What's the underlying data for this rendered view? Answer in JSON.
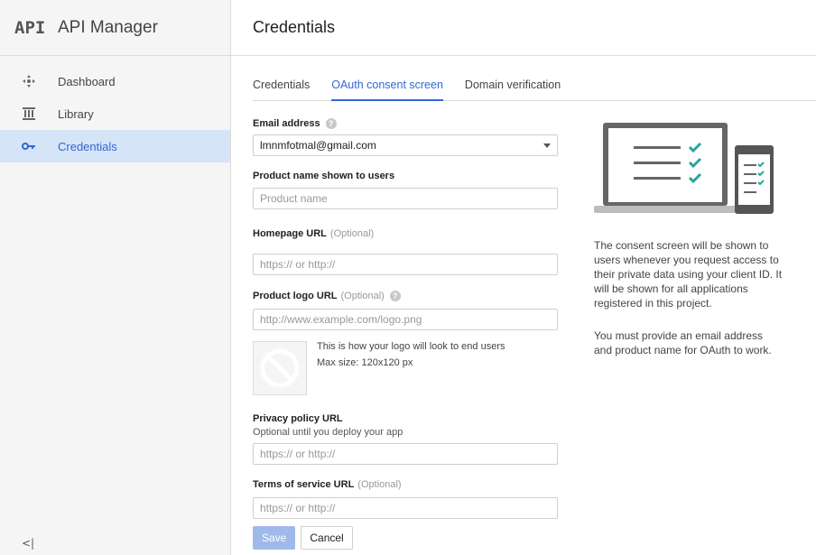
{
  "sidebar": {
    "logo": "API",
    "title": "API Manager",
    "items": [
      {
        "label": "Dashboard",
        "icon": "dashboard-icon"
      },
      {
        "label": "Library",
        "icon": "library-icon"
      },
      {
        "label": "Credentials",
        "icon": "key-icon",
        "active": true
      }
    ],
    "collapse": "<|"
  },
  "header": {
    "title": "Credentials"
  },
  "tabs": [
    {
      "label": "Credentials"
    },
    {
      "label": "OAuth consent screen",
      "active": true
    },
    {
      "label": "Domain verification"
    }
  ],
  "form": {
    "email": {
      "label": "Email address",
      "value": "lmnmfotmal@gmail.com"
    },
    "product_name": {
      "label": "Product name shown to users",
      "placeholder": "Product name"
    },
    "homepage": {
      "label": "Homepage URL",
      "optional": "(Optional)",
      "placeholder": "https:// or http://"
    },
    "logo_url": {
      "label": "Product logo URL",
      "optional": "(Optional)",
      "placeholder": "http://www.example.com/logo.png"
    },
    "logo_preview": {
      "caption": "This is how your logo will look to end users",
      "max_size": "Max size: 120x120 px"
    },
    "privacy": {
      "label": "Privacy policy URL",
      "sub": "Optional until you deploy your app",
      "placeholder": "https:// or http://"
    },
    "tos": {
      "label": "Terms of service URL",
      "optional": "(Optional)",
      "placeholder": "https:// or http://"
    },
    "save": "Save",
    "cancel": "Cancel"
  },
  "info": {
    "p1": "The consent screen will be shown to users whenever you request access to their private data using your client ID. It will be shown for all applications registered in this project.",
    "p2": "You must provide an email address and product name for OAuth to work."
  },
  "colors": {
    "accent": "#3367d6",
    "active_bg": "#d6e4f7",
    "check": "#26a69a",
    "save_disabled": "#9fb9ea"
  }
}
